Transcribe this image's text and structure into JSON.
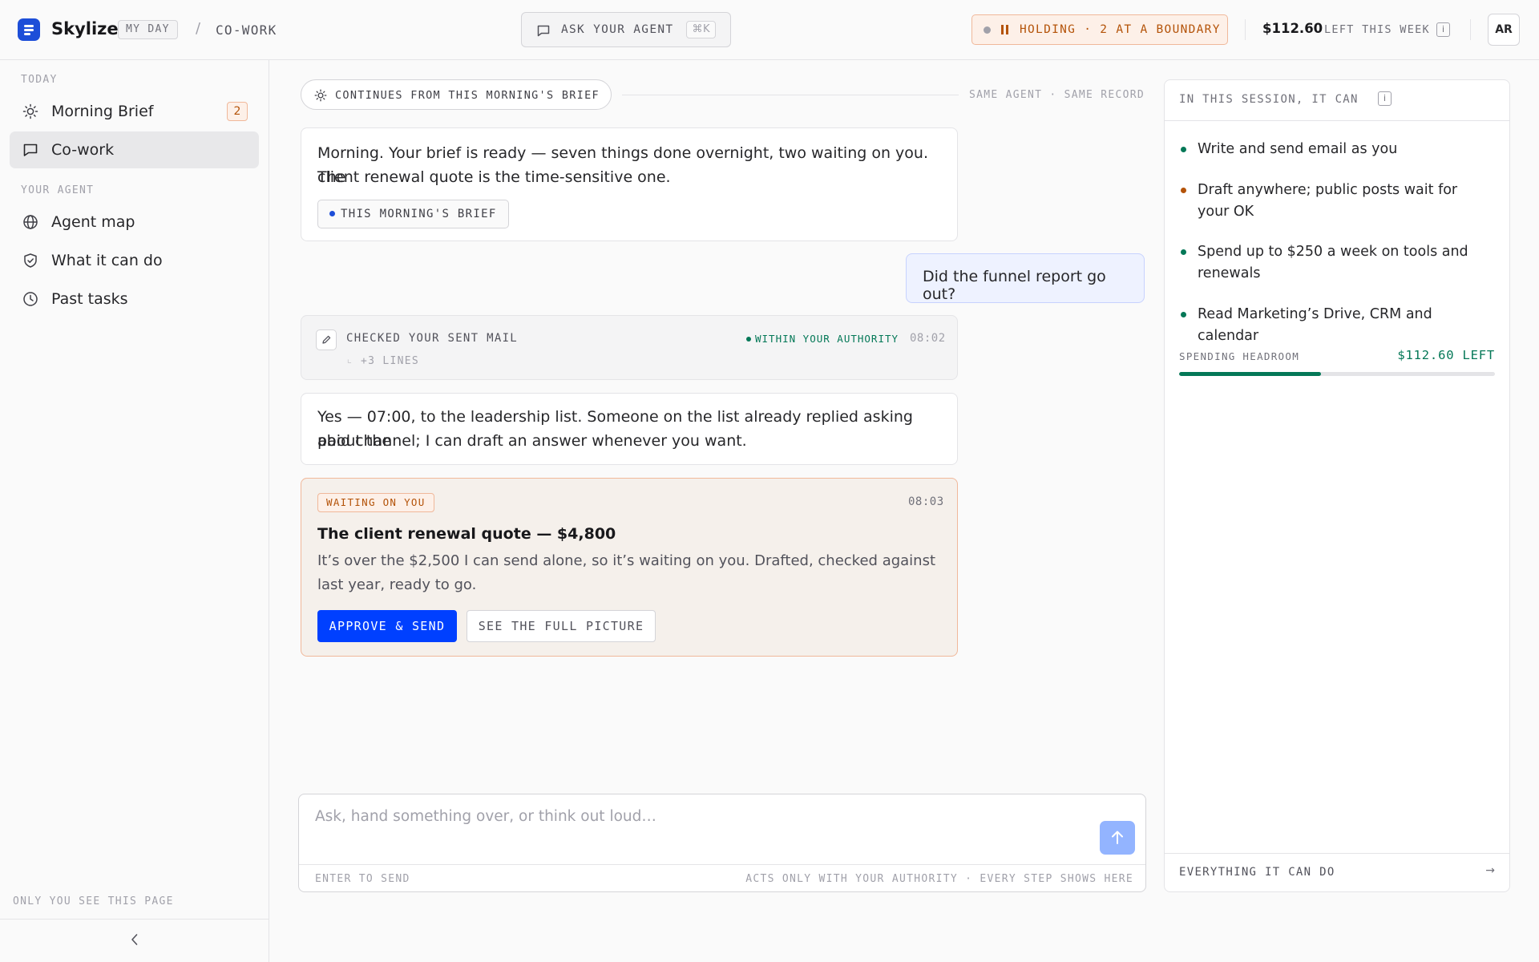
{
  "header": {
    "brand": "Skylize",
    "breadcrumb_parent": "MY DAY",
    "breadcrumb_separator": "/",
    "breadcrumb_current": "CO-WORK",
    "ask_label": "ASK YOUR AGENT",
    "ask_shortcut": "⌘K",
    "holding_status": "HOLDING · 2 AT A BOUNDARY",
    "budget_amount": "$112.60",
    "budget_label": "LEFT THIS WEEK",
    "info_glyph": "i",
    "avatar_initials": "AR"
  },
  "sidebar": {
    "section_today": "TODAY",
    "section_agent": "YOUR AGENT",
    "items": [
      {
        "label": "Morning Brief",
        "icon": "sun-icon",
        "badge": "2",
        "active": false
      },
      {
        "label": "Co-work",
        "icon": "chat-icon",
        "active": true
      },
      {
        "label": "Agent map",
        "icon": "globe-icon",
        "active": false
      },
      {
        "label": "What it can do",
        "icon": "shield-check-icon",
        "active": false
      },
      {
        "label": "Past tasks",
        "icon": "clock-icon",
        "active": false
      }
    ],
    "footer_note": "ONLY YOU SEE THIS PAGE"
  },
  "thread": {
    "continues_label": "CONTINUES FROM THIS MORNING'S BRIEF",
    "context_note": "SAME AGENT · SAME RECORD",
    "agent_message_1": {
      "line1": "Morning. Your brief is ready — seven things done overnight, two waiting on you. The",
      "line2": "client renewal quote is the time-sensitive one.",
      "chip": "THIS MORNING'S BRIEF"
    },
    "user_message": "Did the funnel report go out?",
    "action": {
      "title": "CHECKED YOUR SENT MAIL",
      "more": "+3 LINES",
      "status": "WITHIN YOUR AUTHORITY",
      "time": "08:02"
    },
    "agent_message_2": {
      "line1": "Yes — 07:00, to the leadership list. Someone on the list already replied asking about the",
      "line2": "paid channel; I can draft an answer whenever you want."
    },
    "waiting": {
      "tag": "WAITING ON YOU",
      "time": "08:03",
      "title": "The client renewal quote — $4,800",
      "body": "It’s over the $2,500 I can send alone, so it’s waiting on you. Drafted, checked against last year, ready to go.",
      "approve_label": "APPROVE & SEND",
      "picture_label": "SEE THE FULL PICTURE"
    }
  },
  "composer": {
    "placeholder": "Ask, hand something over, or think out loud…",
    "hint_left": "ENTER TO SEND",
    "hint_right": "ACTS ONLY WITH YOUR AUTHORITY · EVERY STEP SHOWS HERE"
  },
  "panel": {
    "heading": "IN THIS SESSION, IT CAN",
    "capabilities": [
      {
        "text": "Write and send email as you",
        "color": "#047857"
      },
      {
        "text": "Draft anywhere; public posts wait for your OK",
        "color": "#b45309"
      },
      {
        "text": "Spend up to $250 a week on tools and renewals",
        "color": "#047857"
      },
      {
        "text": "Read Marketing’s Drive, CRM and calendar",
        "color": "#047857"
      }
    ],
    "headroom_label": "SPENDING HEADROOM",
    "headroom_value": "$112.60 LEFT",
    "headroom_fraction": 0.45,
    "footer_link": "EVERYTHING IT CAN DO",
    "footer_arrow": "→"
  },
  "colors": {
    "accent": "#0040ff",
    "brand": "#1d4ed8",
    "warning": "#b45309",
    "ok": "#047857"
  }
}
